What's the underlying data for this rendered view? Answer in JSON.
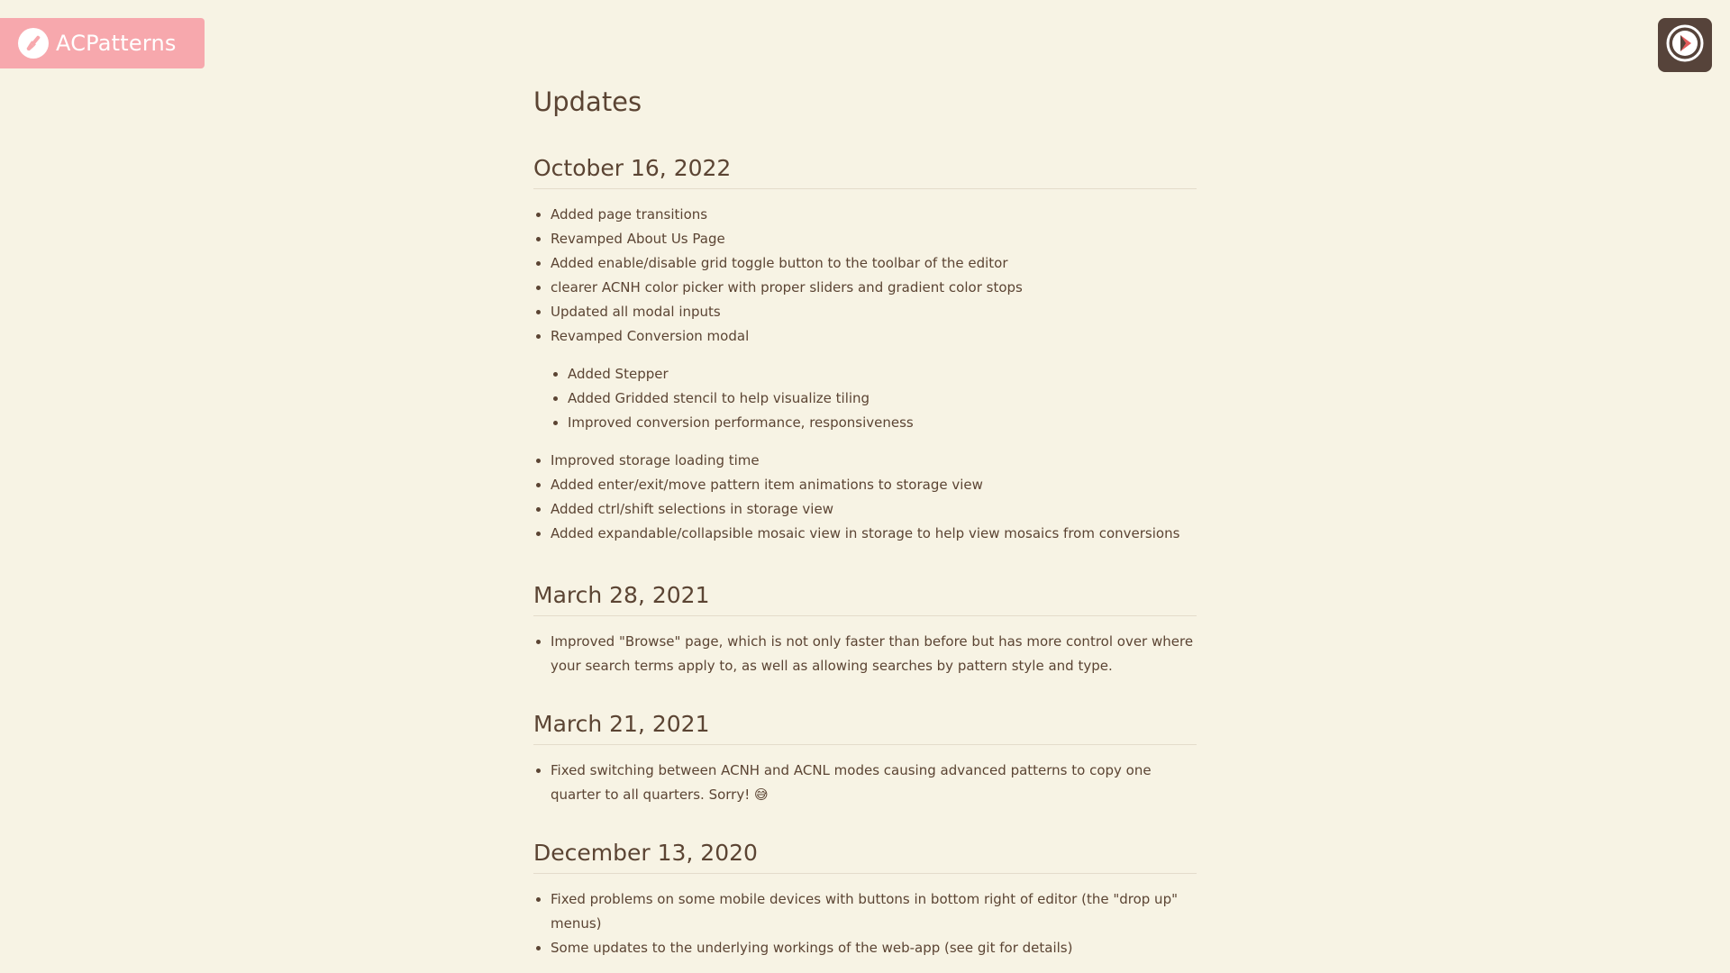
{
  "brand": {
    "name": "ACPatterns",
    "logo_icon": "brush-icon",
    "color": "#f7a8ad"
  },
  "nav": {
    "icon": "compass-icon",
    "color": "#56433a"
  },
  "page": {
    "title": "Updates"
  },
  "sections": [
    {
      "date": "October 16, 2022",
      "items": [
        "Added page transitions",
        "Revamped About Us Page",
        "Added enable/disable grid toggle button to the toolbar of the editor",
        "clearer ACNH color picker with proper sliders and gradient color stops",
        "Updated all modal inputs",
        "Revamped Conversion modal"
      ],
      "subitems": [
        "Added Stepper",
        "Added Gridded stencil to help visualize tiling",
        "Improved conversion performance, responsiveness"
      ],
      "items_after": [
        "Improved storage loading time",
        "Added enter/exit/move pattern item animations to storage view",
        "Added ctrl/shift selections in storage view",
        "Added expandable/collapsible mosaic view in storage to help view mosaics from conversions"
      ]
    },
    {
      "date": "March 28, 2021",
      "items": [
        "Improved \"Browse\" page, which is not only faster than before but has more control over where your search terms apply to, as well as allowing searches by pattern style and type."
      ]
    },
    {
      "date": "March 21, 2021",
      "items": [
        "Fixed switching between ACNH and ACNL modes causing advanced patterns to copy one quarter to all quarters. Sorry! 😅"
      ]
    },
    {
      "date": "December 13, 2020",
      "items": [
        "Fixed problems on some mobile devices with buttons in bottom right of editor (the \"drop up\" menus)",
        "Some updates to the underlying workings of the web-app (see git for details)"
      ]
    }
  ]
}
